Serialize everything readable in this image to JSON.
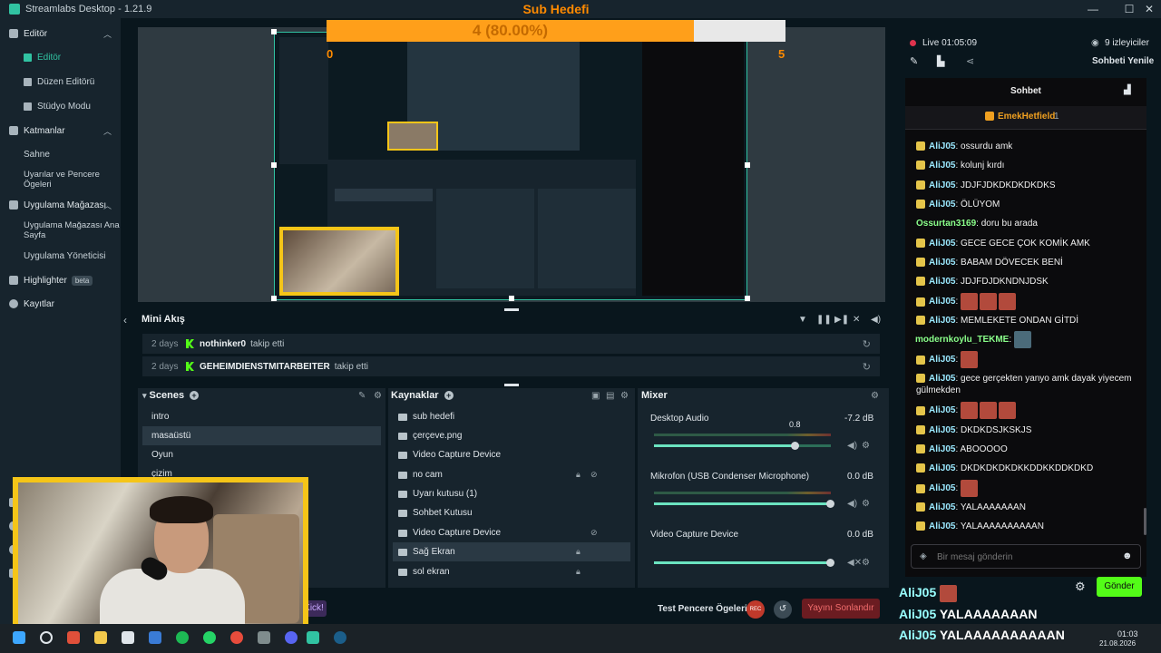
{
  "app": {
    "title": "Streamlabs Desktop - 1.21.9"
  },
  "sidebar": {
    "editor_section": "Editör",
    "editor_item": "Editör",
    "layout_editor": "Düzen Editörü",
    "studio_mode": "Stüdyo Modu",
    "layers_section": "Katmanlar",
    "scene": "Sahne",
    "apps_windows": "Uyarılar ve Pencere Ögeleri",
    "app_store_section": "Uygulama Mağazası",
    "app_store_home": "Uygulama Mağazası Ana Sayfa",
    "app_manager": "Uygulama Yöneticisi",
    "highlighter": "Highlighter",
    "highlighter_badge": "beta",
    "recordings": "Kayıtlar"
  },
  "overlay": {
    "goal_title": "Sub Hedefi",
    "goal_text": "4 (80.00%)",
    "goal_progress": 0.8,
    "goal_min": "0",
    "goal_max": "5",
    "goal_color": "#ff9f1a"
  },
  "mini_feed": {
    "title": "Mini Akış",
    "events": [
      {
        "age": "2 days",
        "user": "nothinker0",
        "action": "takip etti"
      },
      {
        "age": "2 days",
        "user": "GEHEIMDIENSTMITARBEITER",
        "action": "takip etti"
      }
    ]
  },
  "scenes": {
    "title": "Scenes",
    "items": [
      "intro",
      "masaüstü",
      "Oyun",
      "çizim"
    ],
    "selected": "masaüstü"
  },
  "sources": {
    "title": "Kaynaklar",
    "items": [
      "sub hedefi",
      "çerçeve.png",
      "Video Capture Device",
      "no cam",
      "Uyarı kutusu (1)",
      "Sohbet Kutusu",
      "Video Capture Device",
      "Sağ Ekran",
      "sol ekran"
    ],
    "selected": "Sağ Ekran"
  },
  "mixer": {
    "title": "Mixer",
    "channels": [
      {
        "name": "Desktop Audio",
        "db": "-7.2 dB",
        "volume": 0.8,
        "volume_label": "0.8"
      },
      {
        "name": "Mikrofon (USB Condenser Microphone)",
        "db": "0.0 dB",
        "volume": 1.0
      },
      {
        "name": "Video Capture Device",
        "db": "0.0 dB",
        "volume": 1.0
      }
    ]
  },
  "bottom": {
    "test_label": "Test Pencere Ögeleri",
    "rec_label": "REC",
    "end_stream": "Yayını Sonlandır",
    "kick_label": "Kick!"
  },
  "live": {
    "status": "Live 01:05:09",
    "viewers": "9 izleyiciler",
    "refresh_chat": "Sohbeti Yenile"
  },
  "chat": {
    "title": "Sohbet",
    "pinned_user": "EmekHetfield",
    "pinned_count": "1",
    "messages": [
      {
        "user": "AliJ05",
        "text": "ossurdu amk"
      },
      {
        "user": "AliJ05",
        "text": "kolunj kırdı"
      },
      {
        "user": "AliJ05",
        "text": "JDJFJDKDKDKDKDKS"
      },
      {
        "user": "AliJ05",
        "text": "ÖLÜYOM"
      },
      {
        "user": "Ossurtan3169",
        "text": "doru bu arada"
      },
      {
        "user": "AliJ05",
        "text": "GECE GECE ÇOK KOMİK AMK"
      },
      {
        "user": "AliJ05",
        "text": "BABAM DÖVECEK BENİ"
      },
      {
        "user": "AliJ05",
        "text": "JDJFDJDKNDNJDSK"
      },
      {
        "user": "AliJ05",
        "text": ""
      },
      {
        "user": "AliJ05",
        "text": "MEMLEKETE ONDAN GİTDİ"
      },
      {
        "user": "modernkoylu_TEKME",
        "text": ""
      },
      {
        "user": "AliJ05",
        "text": ""
      },
      {
        "user": "AliJ05",
        "text": "gece gerçekten yanyo amk dayak yiyecem gülmekden"
      },
      {
        "user": "AliJ05",
        "text": ""
      },
      {
        "user": "AliJ05",
        "text": "DKDKDSJKSKJS"
      },
      {
        "user": "AliJ05",
        "text": "ABOOOOO"
      },
      {
        "user": "AliJ05",
        "text": "DKDKDKDKDKKDDKKDDKDKD"
      },
      {
        "user": "AliJ05",
        "text": ""
      },
      {
        "user": "AliJ05",
        "text": "YALAAAAAAAN"
      },
      {
        "user": "AliJ05",
        "text": "YALAAAAAAAAAAN"
      }
    ],
    "input_placeholder": "Bir mesaj gönderin",
    "send_label": "Gönder"
  },
  "overlay_chat": [
    {
      "user": "AliJ05",
      "text": ""
    },
    {
      "user": "AliJ05",
      "text": "YALAAAAAAAN"
    },
    {
      "user": "AliJ05",
      "text": "YALAAAAAAAAAAN"
    }
  ],
  "taskbar": {
    "time": "01:03",
    "date": "21.08.2026"
  },
  "colors": {
    "accent": "#31c3a2",
    "kick_green": "#53fc18",
    "goal_orange": "#ff8a00",
    "end_red": "#6b1c21"
  }
}
